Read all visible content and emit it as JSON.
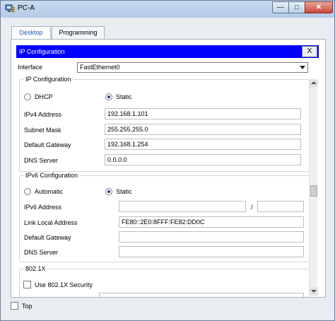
{
  "window": {
    "title": "PC-A"
  },
  "tabs": [
    {
      "label": "Desktop",
      "active": true
    },
    {
      "label": "Programming",
      "active": false
    }
  ],
  "panel": {
    "title": "IP Configuration",
    "close_label": "X"
  },
  "interface": {
    "label": "Interface",
    "value": "FastEthernet0"
  },
  "ipv4": {
    "title": "IP Configuration",
    "dhcp_label": "DHCP",
    "static_label": "Static",
    "mode": "static",
    "fields": [
      {
        "label": "IPv4 Address",
        "value": "192.168.1.101"
      },
      {
        "label": "Subnet Mask",
        "value": "255.255.255.0"
      },
      {
        "label": "Default Gateway",
        "value": "192.168.1.254"
      },
      {
        "label": "DNS Server",
        "value": "0.0.0.0"
      }
    ]
  },
  "ipv6": {
    "title": "IPv6 Configuration",
    "automatic_label": "Automatic",
    "static_label": "Static",
    "mode": "static",
    "address_label": "IPv6 Address",
    "address_value": "",
    "prefix_separator": "/",
    "prefix_value": "",
    "link_local_label": "Link Local Address",
    "link_local_value": "FE80::2E0:8FFF:FE82:DD0C",
    "gateway_label": "Default Gateway",
    "gateway_value": "",
    "dns_label": "DNS Server",
    "dns_value": ""
  },
  "dot1x": {
    "title": "802.1X",
    "use_label": "Use 802.1X Security",
    "checked": false
  },
  "footer": {
    "top_label": "Top",
    "top_checked": false
  },
  "colors": {
    "panel_header": "#0000ff",
    "active_tab_text": "#1f56b0"
  }
}
